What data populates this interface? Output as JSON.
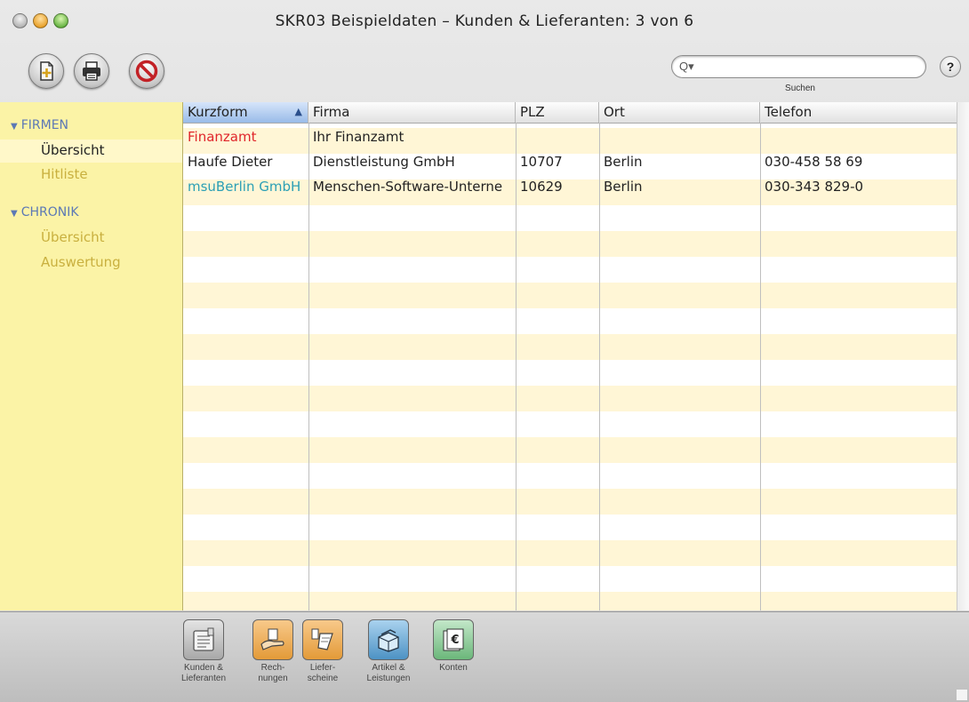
{
  "window": {
    "title": "SKR03 Beispieldaten – Kunden & Lieferanten: 3 von 6"
  },
  "toolbar": {
    "buttons": [
      {
        "name": "new-record",
        "icon": "new-document-icon"
      },
      {
        "name": "print",
        "icon": "printer-icon"
      },
      {
        "name": "delete",
        "icon": "prohibited-icon"
      }
    ],
    "search": {
      "placeholder": "",
      "value": "",
      "label": "Suchen",
      "icon": "search-icon"
    },
    "help_label": "?"
  },
  "sidebar": {
    "sections": [
      {
        "title": "FIRMEN",
        "items": [
          {
            "label": "Übersicht",
            "selected": true
          },
          {
            "label": "Hitliste",
            "selected": false
          }
        ]
      },
      {
        "title": "CHRONIK",
        "items": [
          {
            "label": "Übersicht",
            "selected": false
          },
          {
            "label": "Auswertung",
            "selected": false
          }
        ]
      }
    ]
  },
  "table": {
    "columns": [
      {
        "label": "Kurzform",
        "sorted": true,
        "sort_glyph": "▲"
      },
      {
        "label": "Firma"
      },
      {
        "label": "PLZ"
      },
      {
        "label": "Ort"
      },
      {
        "label": "Telefon"
      }
    ],
    "rows": [
      {
        "kurzform": "Finanzamt",
        "kurzform_color": "#e0262b",
        "firma": "Ihr Finanzamt",
        "plz": "",
        "ort": "",
        "telefon": ""
      },
      {
        "kurzform": "Haufe Dieter",
        "kurzform_color": "#222222",
        "firma": "Dienstleistung GmbH",
        "plz": "10707",
        "ort": "Berlin",
        "telefon": "030-458 58 69"
      },
      {
        "kurzform": "msuBerlin GmbH",
        "kurzform_color": "#2b9fb5",
        "firma": "Menschen-Software-Unterne",
        "plz": "10629",
        "ort": "Berlin",
        "telefon": "030-343 829-0"
      }
    ]
  },
  "modules": [
    {
      "label": "Kunden &\nLieferanten",
      "icon": "address-book-icon",
      "color": "#b9b9b9"
    },
    {
      "label": "Rech-\nnungen",
      "icon": "invoice-hand-icon",
      "color": "#f0a94a"
    },
    {
      "label": "Liefer-\nscheine",
      "icon": "delivery-note-icon",
      "color": "#f0a94a"
    },
    {
      "label": "Artikel &\nLeistungen",
      "icon": "product-box-icon",
      "color": "#5aa0d0"
    },
    {
      "label": "Konten",
      "icon": "euro-ledger-icon",
      "color": "#7fc28a"
    }
  ]
}
